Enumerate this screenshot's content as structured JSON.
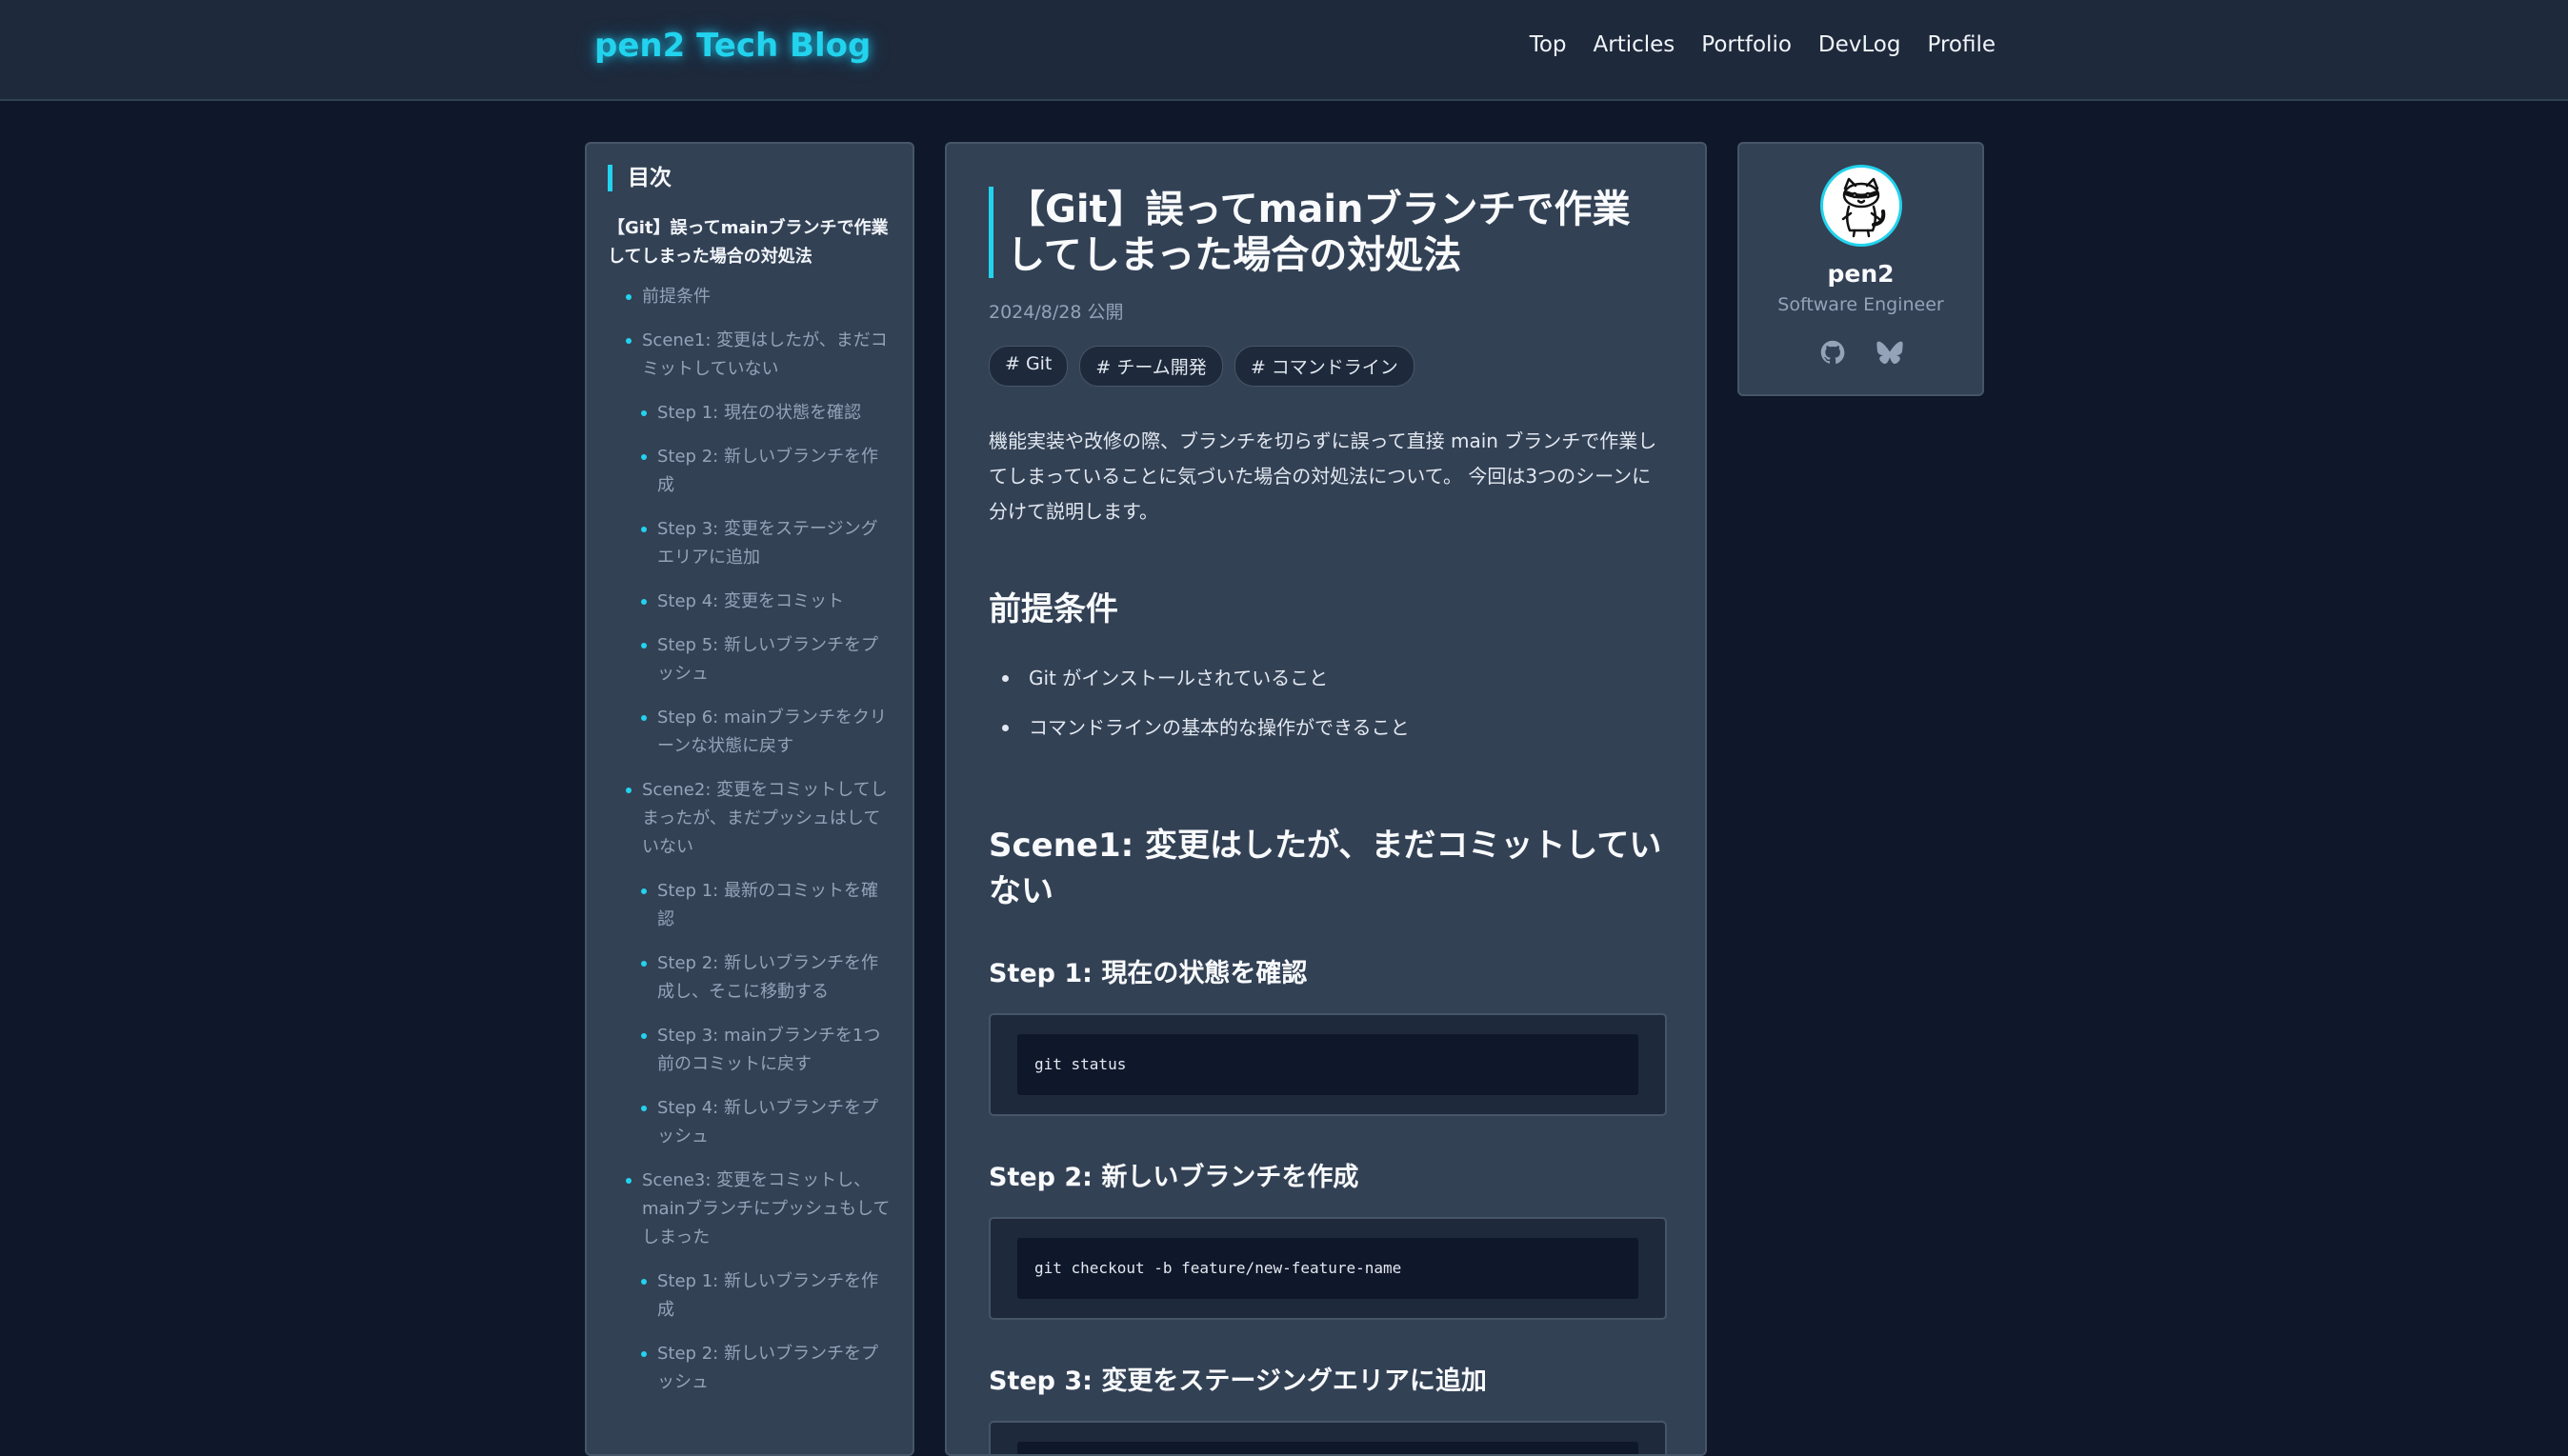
{
  "header": {
    "brand": "pen2 Tech Blog",
    "nav": [
      "Top",
      "Articles",
      "Portfolio",
      "DevLog",
      "Profile"
    ]
  },
  "toc": {
    "heading": "目次",
    "title": "【Git】誤ってmainブランチで作業してしまった場合の対処法",
    "items": [
      "前提条件",
      "Scene1: 変更はしたが、まだコミットしていない",
      "Step 1: 現在の状態を確認",
      "Step 2: 新しいブランチを作成",
      "Step 3: 変更をステージングエリアに追加",
      "Step 4: 変更をコミット",
      "Step 5: 新しいブランチをプッシュ",
      "Step 6: mainブランチをクリーンな状態に戻す",
      "Scene2: 変更をコミットしてしまったが、まだプッシュはしていない",
      "Step 1: 最新のコミットを確認",
      "Step 2: 新しいブランチを作成し、そこに移動する",
      "Step 3: mainブランチを1つ前のコミットに戻す",
      "Step 4: 新しいブランチをプッシュ",
      "Scene3: 変更をコミットし、mainブランチにプッシュもしてしまった",
      "Step 1: 新しいブランチを作成",
      "Step 2: 新しいブランチをプッシュ"
    ]
  },
  "article": {
    "title": "【Git】誤ってmainブランチで作業してしまった場合の対処法",
    "date": "2024/8/28 公開",
    "tags": [
      "# Git",
      "# チーム開発",
      "# コマンドライン"
    ],
    "intro": "機能実装や改修の際、ブランチを切らずに誤って直接 main ブランチで作業してしまっていることに気づいた場合の対処法について。 今回は3つのシーンに分けて説明します。",
    "sections": {
      "prereq_heading": "前提条件",
      "prereq_items": [
        "Git がインストールされていること",
        "コマンドラインの基本的な操作ができること"
      ],
      "scene1_heading": "Scene1: 変更はしたが、まだコミットしていない",
      "step1_heading": "Step 1: 現在の状態を確認",
      "step1_code": "git status",
      "step2_heading": "Step 2: 新しいブランチを作成",
      "step2_code": "git checkout -b feature/new-feature-name",
      "step3_heading": "Step 3: 変更をステージングエリアに追加"
    }
  },
  "profile": {
    "name": "pen2",
    "role": "Software Engineer",
    "avatar_icon": "raccoon-avatar-icon",
    "socials": [
      "github-icon",
      "bluesky-icon"
    ]
  },
  "colors": {
    "background": "#0f172a",
    "header": "#1e293b",
    "panel": "#334155",
    "accent": "#22d3ee"
  }
}
